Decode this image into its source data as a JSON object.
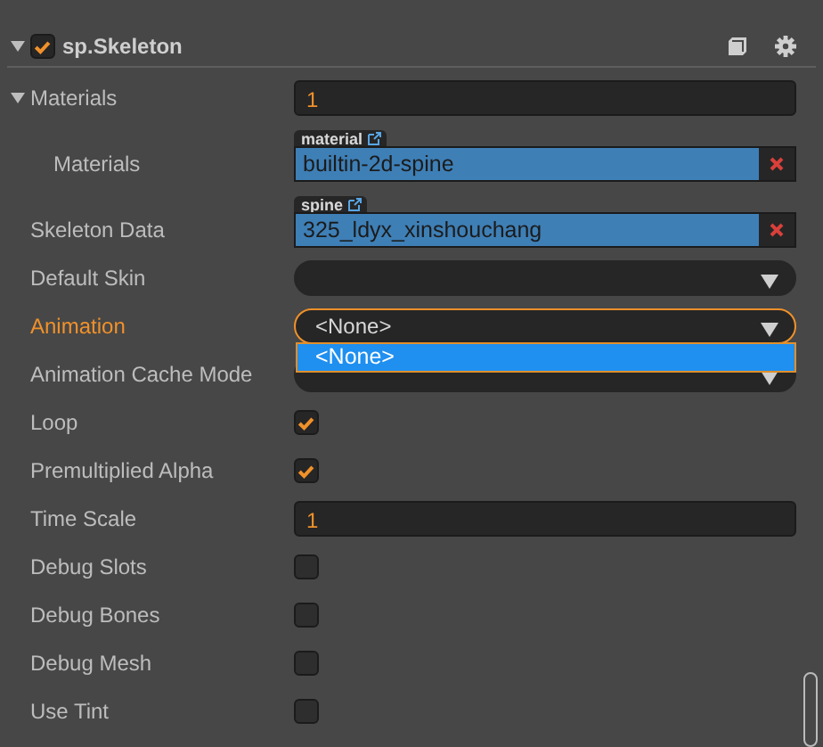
{
  "component": {
    "title": "sp.Skeleton",
    "enabled": true,
    "expanded": true
  },
  "properties": [
    {
      "kind": "array",
      "label": "Materials",
      "expanded": true,
      "value": "1",
      "children": [
        {
          "kind": "asset",
          "label": "Materials",
          "tag": "material",
          "value": "builtin-2d-spine"
        }
      ]
    },
    {
      "kind": "asset",
      "label": "Skeleton Data",
      "tag": "spine",
      "value": "325_ldyx_xinshouchang"
    },
    {
      "kind": "dropdown",
      "label": "Default Skin",
      "focused": false
    },
    {
      "kind": "dropdown",
      "label": "Animation",
      "value": "<None>",
      "focused": true,
      "options": [
        {
          "label": "<None>",
          "selected": true
        }
      ]
    },
    {
      "kind": "dropdown",
      "label": "Animation Cache Mode",
      "focused": false
    },
    {
      "kind": "checkbox",
      "label": "Loop",
      "checked": true
    },
    {
      "kind": "checkbox",
      "label": "Premultiplied Alpha",
      "checked": true
    },
    {
      "kind": "number",
      "label": "Time Scale",
      "value": "1"
    },
    {
      "kind": "checkbox",
      "label": "Debug Slots",
      "checked": false
    },
    {
      "kind": "checkbox",
      "label": "Debug Bones",
      "checked": false
    },
    {
      "kind": "checkbox",
      "label": "Debug Mesh",
      "checked": false
    },
    {
      "kind": "checkbox",
      "label": "Use Tint",
      "checked": false
    }
  ]
}
